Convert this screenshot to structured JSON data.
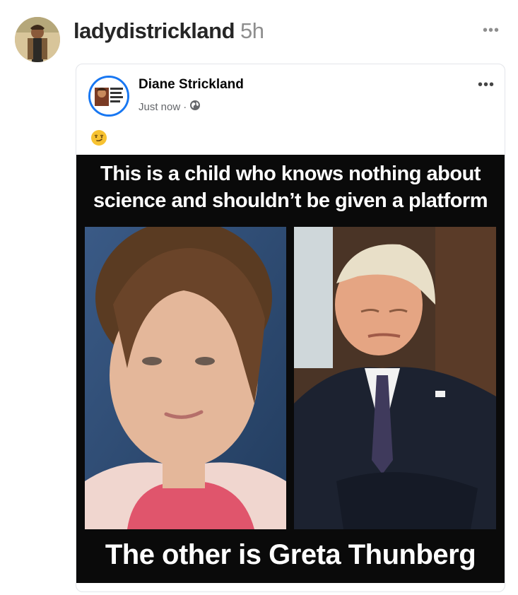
{
  "post": {
    "username": "ladydistrickland",
    "time": "5h",
    "more_icon": "ellipsis-icon"
  },
  "shared_card": {
    "author_name": "Diane Strickland",
    "timestamp": "Just now",
    "separator": "·",
    "audience_icon": "globe-icon",
    "reaction_emoji": "😏",
    "more_icon": "ellipsis-icon"
  },
  "meme": {
    "top_caption_line1": "This is a child who knows nothing about",
    "top_caption_line2": "science and shouldn’t be given a platform",
    "bottom_caption": "The other is Greta Thunberg"
  },
  "colors": {
    "facebook_blue": "#1877f2",
    "text_dark": "#262626",
    "text_muted": "#8e8e8e"
  }
}
